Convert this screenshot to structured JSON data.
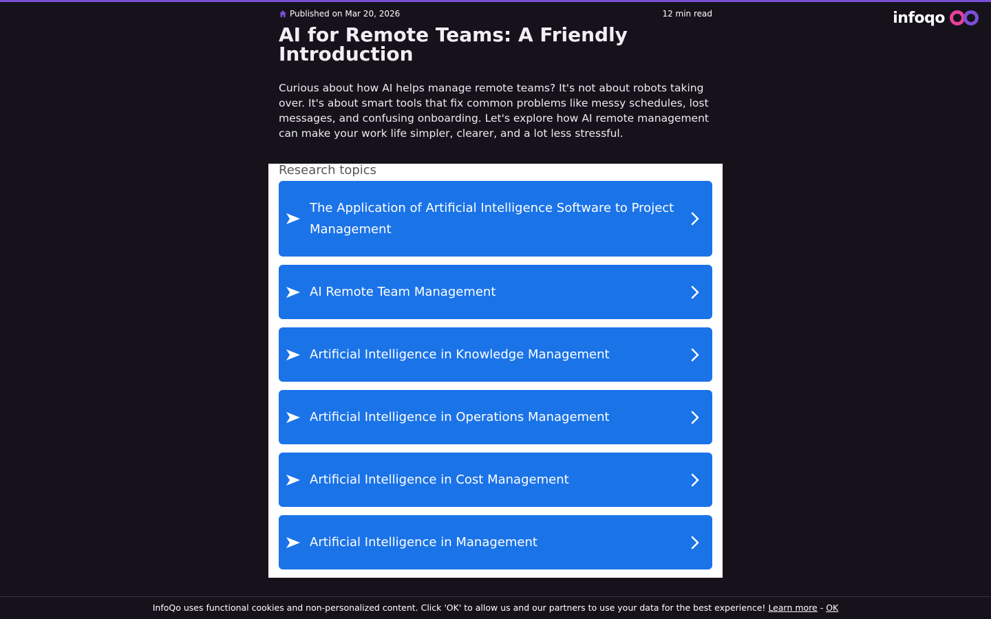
{
  "brand": {
    "logo_text": "infoqo"
  },
  "article": {
    "published": "Published on Mar 20, 2026",
    "read_time": "12 min read",
    "title": "AI for Remote Teams: A Friendly Introduction",
    "intro": "Curious about how AI helps manage remote teams? It's not about robots taking over. It's about smart tools that fix common problems like messy schedules, lost messages, and confusing onboarding. Let's explore how AI remote management can make your work life simpler, clearer, and a lot less stressful."
  },
  "topics": {
    "heading": "Research topics",
    "items": [
      {
        "label": "The Application of Artificial Intelligence Software to Project Management"
      },
      {
        "label": "AI Remote Team Management"
      },
      {
        "label": "Artificial Intelligence in Knowledge Management"
      },
      {
        "label": "Artificial Intelligence in Operations Management"
      },
      {
        "label": "Artificial Intelligence in Cost Management"
      },
      {
        "label": "Artificial Intelligence in Management"
      }
    ]
  },
  "cookie": {
    "message": "InfoQo uses functional cookies and non-personalized content. Click 'OK' to allow us and our partners to use your data for the best experience!",
    "learn_more": "Learn more",
    "separator": "-",
    "ok": "OK"
  },
  "colors": {
    "background": "#16121b",
    "accent": "#7b4fd6",
    "card": "#1b73e8",
    "logo_pink": "#e8409b",
    "logo_purple": "#7b4fd6"
  }
}
